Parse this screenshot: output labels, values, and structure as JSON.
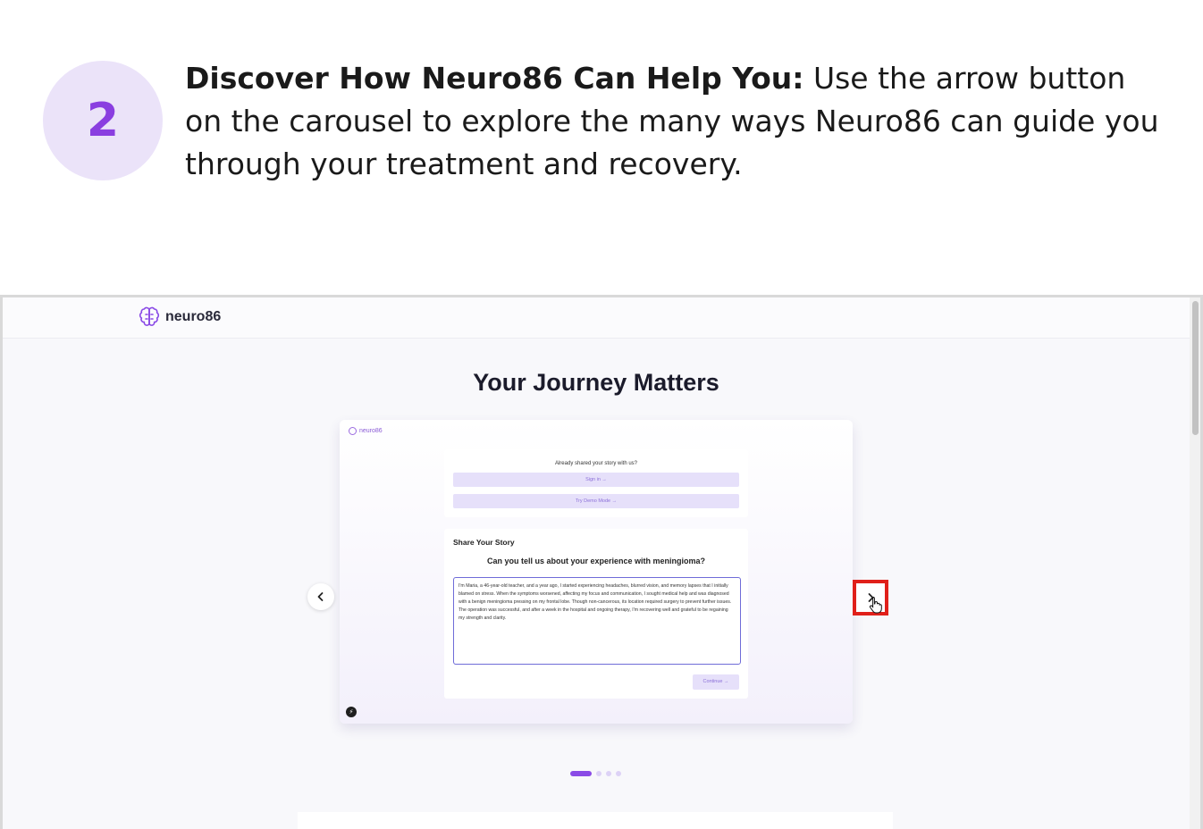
{
  "step": {
    "number": "2",
    "title": "Discover How Neuro86 Can Help You:",
    "text": " Use the arrow button on the carousel to explore the many ways Neuro86 can guide you through your treatment and recovery."
  },
  "navbar": {
    "brand": "neuro86"
  },
  "page": {
    "heading": "Your Journey Matters"
  },
  "slide": {
    "brand": "neuro86",
    "signin_question": "Already shared your story with us?",
    "signin_button": "Sign in →",
    "demo_button": "Try Demo Mode →",
    "story_title": "Share Your Story",
    "story_question": "Can you tell us about your experience with meningioma?",
    "story_text": "I'm Maria, a 46-year-old teacher, and a year ago, I started experiencing headaches, blurred vision, and memory lapses that I initially blamed on stress. When the symptoms worsened, affecting my focus and communication, I sought medical help and was diagnosed with a benign meningioma pressing on my frontal lobe. Though non-cancerous, its location required surgery to prevent further issues. The operation was successful, and after a week in the hospital and ongoing therapy, I'm recovering well and grateful to be regaining my strength and clarity.",
    "continue_button": "Continue →",
    "badge": "⚡"
  },
  "carousel": {
    "prev_icon": "chevron-left-icon",
    "next_icon": "chevron-right-icon",
    "active_index": 0,
    "total": 4
  },
  "colors": {
    "accent": "#8a4be6",
    "highlight": "#e0201a",
    "step_circle": "#ebe3f9"
  }
}
